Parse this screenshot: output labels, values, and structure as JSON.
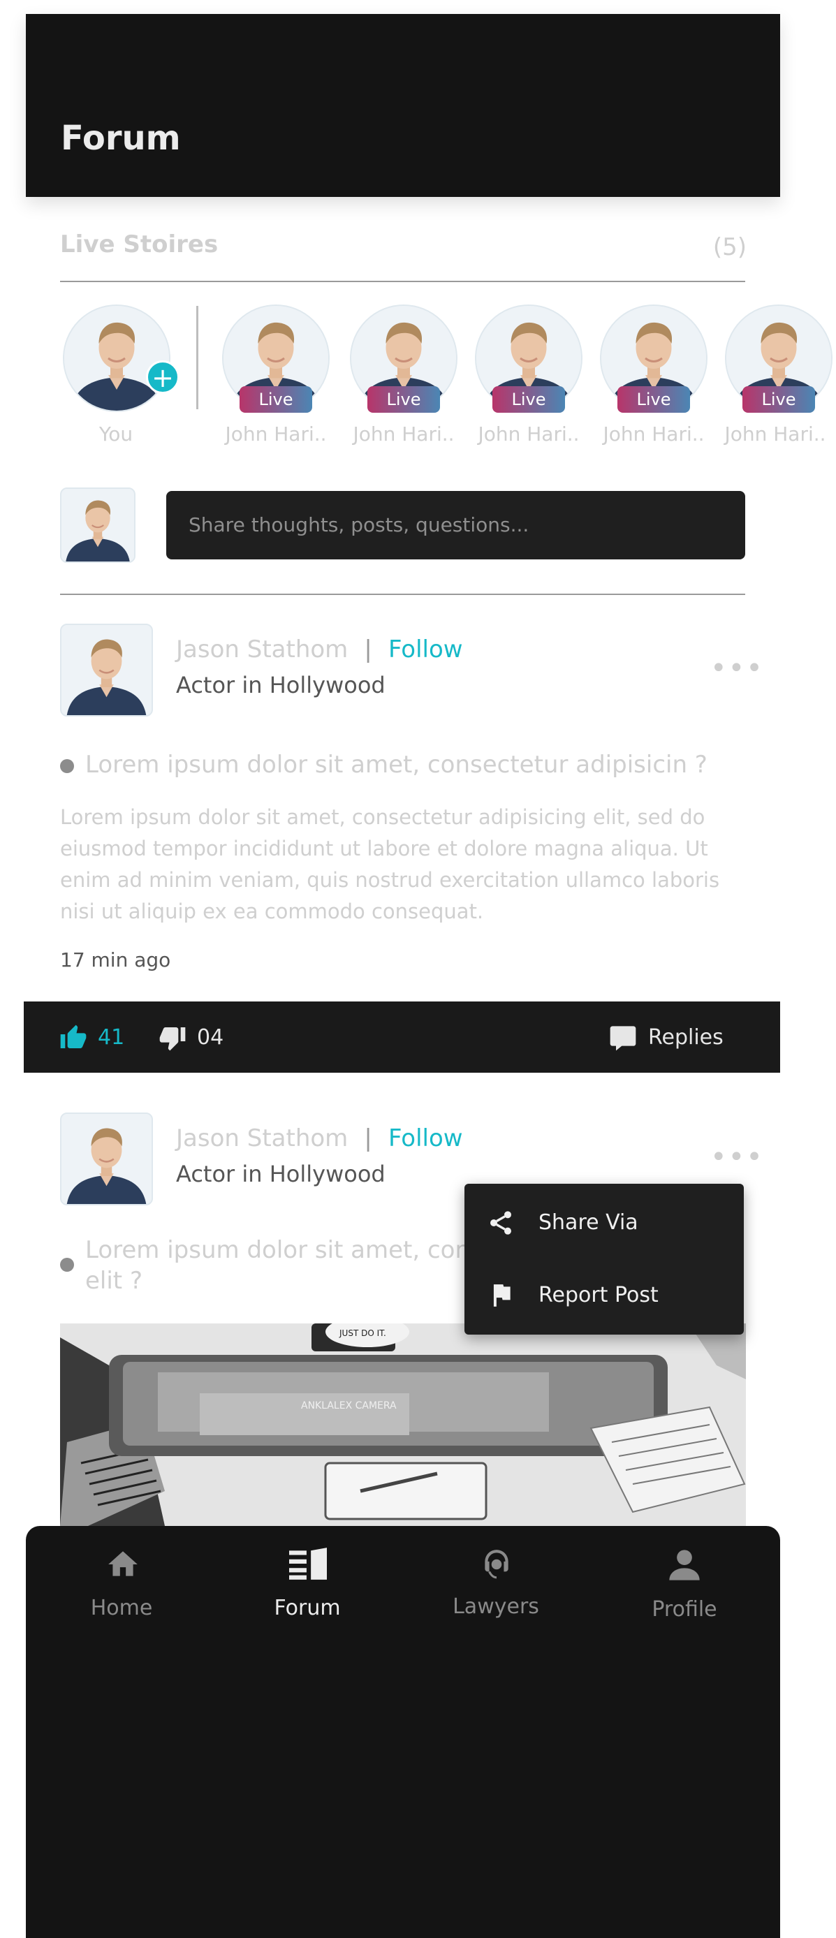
{
  "header": {
    "title": "Forum"
  },
  "stories": {
    "title": "Live Stoires",
    "count": "(5)",
    "own": {
      "name": "You",
      "badge": "+"
    },
    "items": [
      {
        "name": "John Hari..",
        "badge": "Live"
      },
      {
        "name": "John Hari..",
        "badge": "Live"
      },
      {
        "name": "John Hari..",
        "badge": "Live"
      },
      {
        "name": "John Hari..",
        "badge": "Live"
      },
      {
        "name": "John Hari..",
        "badge": "Live"
      }
    ]
  },
  "composer": {
    "placeholder": "Share thoughts, posts, questions..."
  },
  "posts": [
    {
      "author": "Jason Stathom",
      "separator": "|",
      "follow": "Follow",
      "role": "Actor in Hollywood",
      "more": "•••",
      "question": "Lorem ipsum dolor sit amet, consectetur adipisicin ?",
      "body": "Lorem ipsum dolor sit amet, consectetur adipisicing elit, sed do eiusmod tempor incididunt ut labore et dolore magna aliqua. Ut enim ad minim veniam, quis nostrud exercitation ullamco laboris nisi ut aliquip ex ea commodo consequat.",
      "time": "17 min ago",
      "likes": "41",
      "dislikes": "04",
      "replies": "Replies"
    },
    {
      "author": "Jason Stathom",
      "separator": "|",
      "follow": "Follow",
      "role": "Actor in Hollywood",
      "more": "•••",
      "question_line1": "Lorem ipsum dolor sit amet, con",
      "question_line2": "elit ?"
    }
  ],
  "context_menu": {
    "items": [
      {
        "label": "Share Via",
        "icon": "share-icon"
      },
      {
        "label": "Report Post",
        "icon": "flag-icon"
      }
    ]
  },
  "photo_overlay_text": {
    "cap": "JUST DO IT.",
    "screen": "ANKLALEX CAMERA"
  },
  "bottom_nav": {
    "items": [
      {
        "label": "Home",
        "icon": "home-icon",
        "active": false
      },
      {
        "label": "Forum",
        "icon": "forum-icon",
        "active": true
      },
      {
        "label": "Lawyers",
        "icon": "lawyers-icon",
        "active": false
      },
      {
        "label": "Profile",
        "icon": "profile-icon",
        "active": false
      }
    ]
  },
  "colors": {
    "accent": "#16b9c8",
    "dark": "#141414",
    "muted": "#cfcfcf"
  }
}
